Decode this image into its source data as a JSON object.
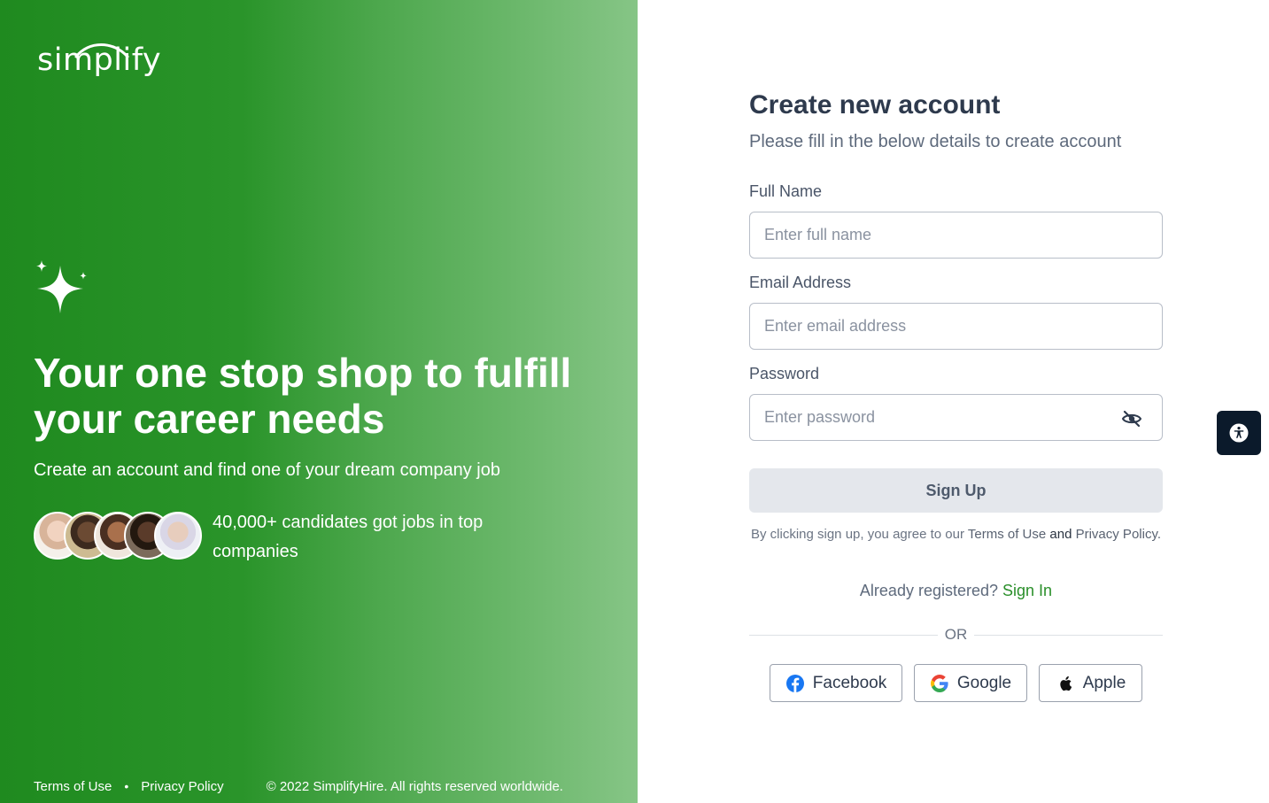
{
  "hero": {
    "logo_text": "simplify",
    "title": "Your one stop shop to fulfill your career needs",
    "subtitle": "Create an account and find one of your dream company job",
    "stat": "40,000+ candidates got jobs in top companies",
    "footer": {
      "terms": "Terms of Use",
      "separator": "•",
      "privacy": "Privacy Policy",
      "copyright": "© 2022 SimplifyHire. All rights reserved worldwide."
    }
  },
  "form": {
    "title": "Create new account",
    "subtitle": "Please fill in the below details to create account",
    "full_name": {
      "label": "Full Name",
      "placeholder": "Enter full name"
    },
    "email": {
      "label": "Email Address",
      "placeholder": "Enter email address"
    },
    "password": {
      "label": "Password",
      "placeholder": "Enter password"
    },
    "signup_label": "Sign Up",
    "terms": {
      "prefix": "By clicking sign up, you agree to our",
      "terms_link": "Terms of Use",
      "and": "and",
      "privacy_link": "Privacy Policy."
    },
    "already_text": "Already registered?",
    "signin_link": "Sign In",
    "or_text": "OR",
    "social": [
      {
        "label": "Facebook",
        "icon": "facebook-icon"
      },
      {
        "label": "Google",
        "icon": "google-icon"
      },
      {
        "label": "Apple",
        "icon": "apple-icon"
      }
    ]
  },
  "accessibility_icon": "accessibility-icon",
  "colors": {
    "brand_green": "#2a8f2a",
    "heading": "#2e3a4d",
    "button_disabled": "#e4e7ec",
    "a11y_dark": "#0b1a2b"
  }
}
